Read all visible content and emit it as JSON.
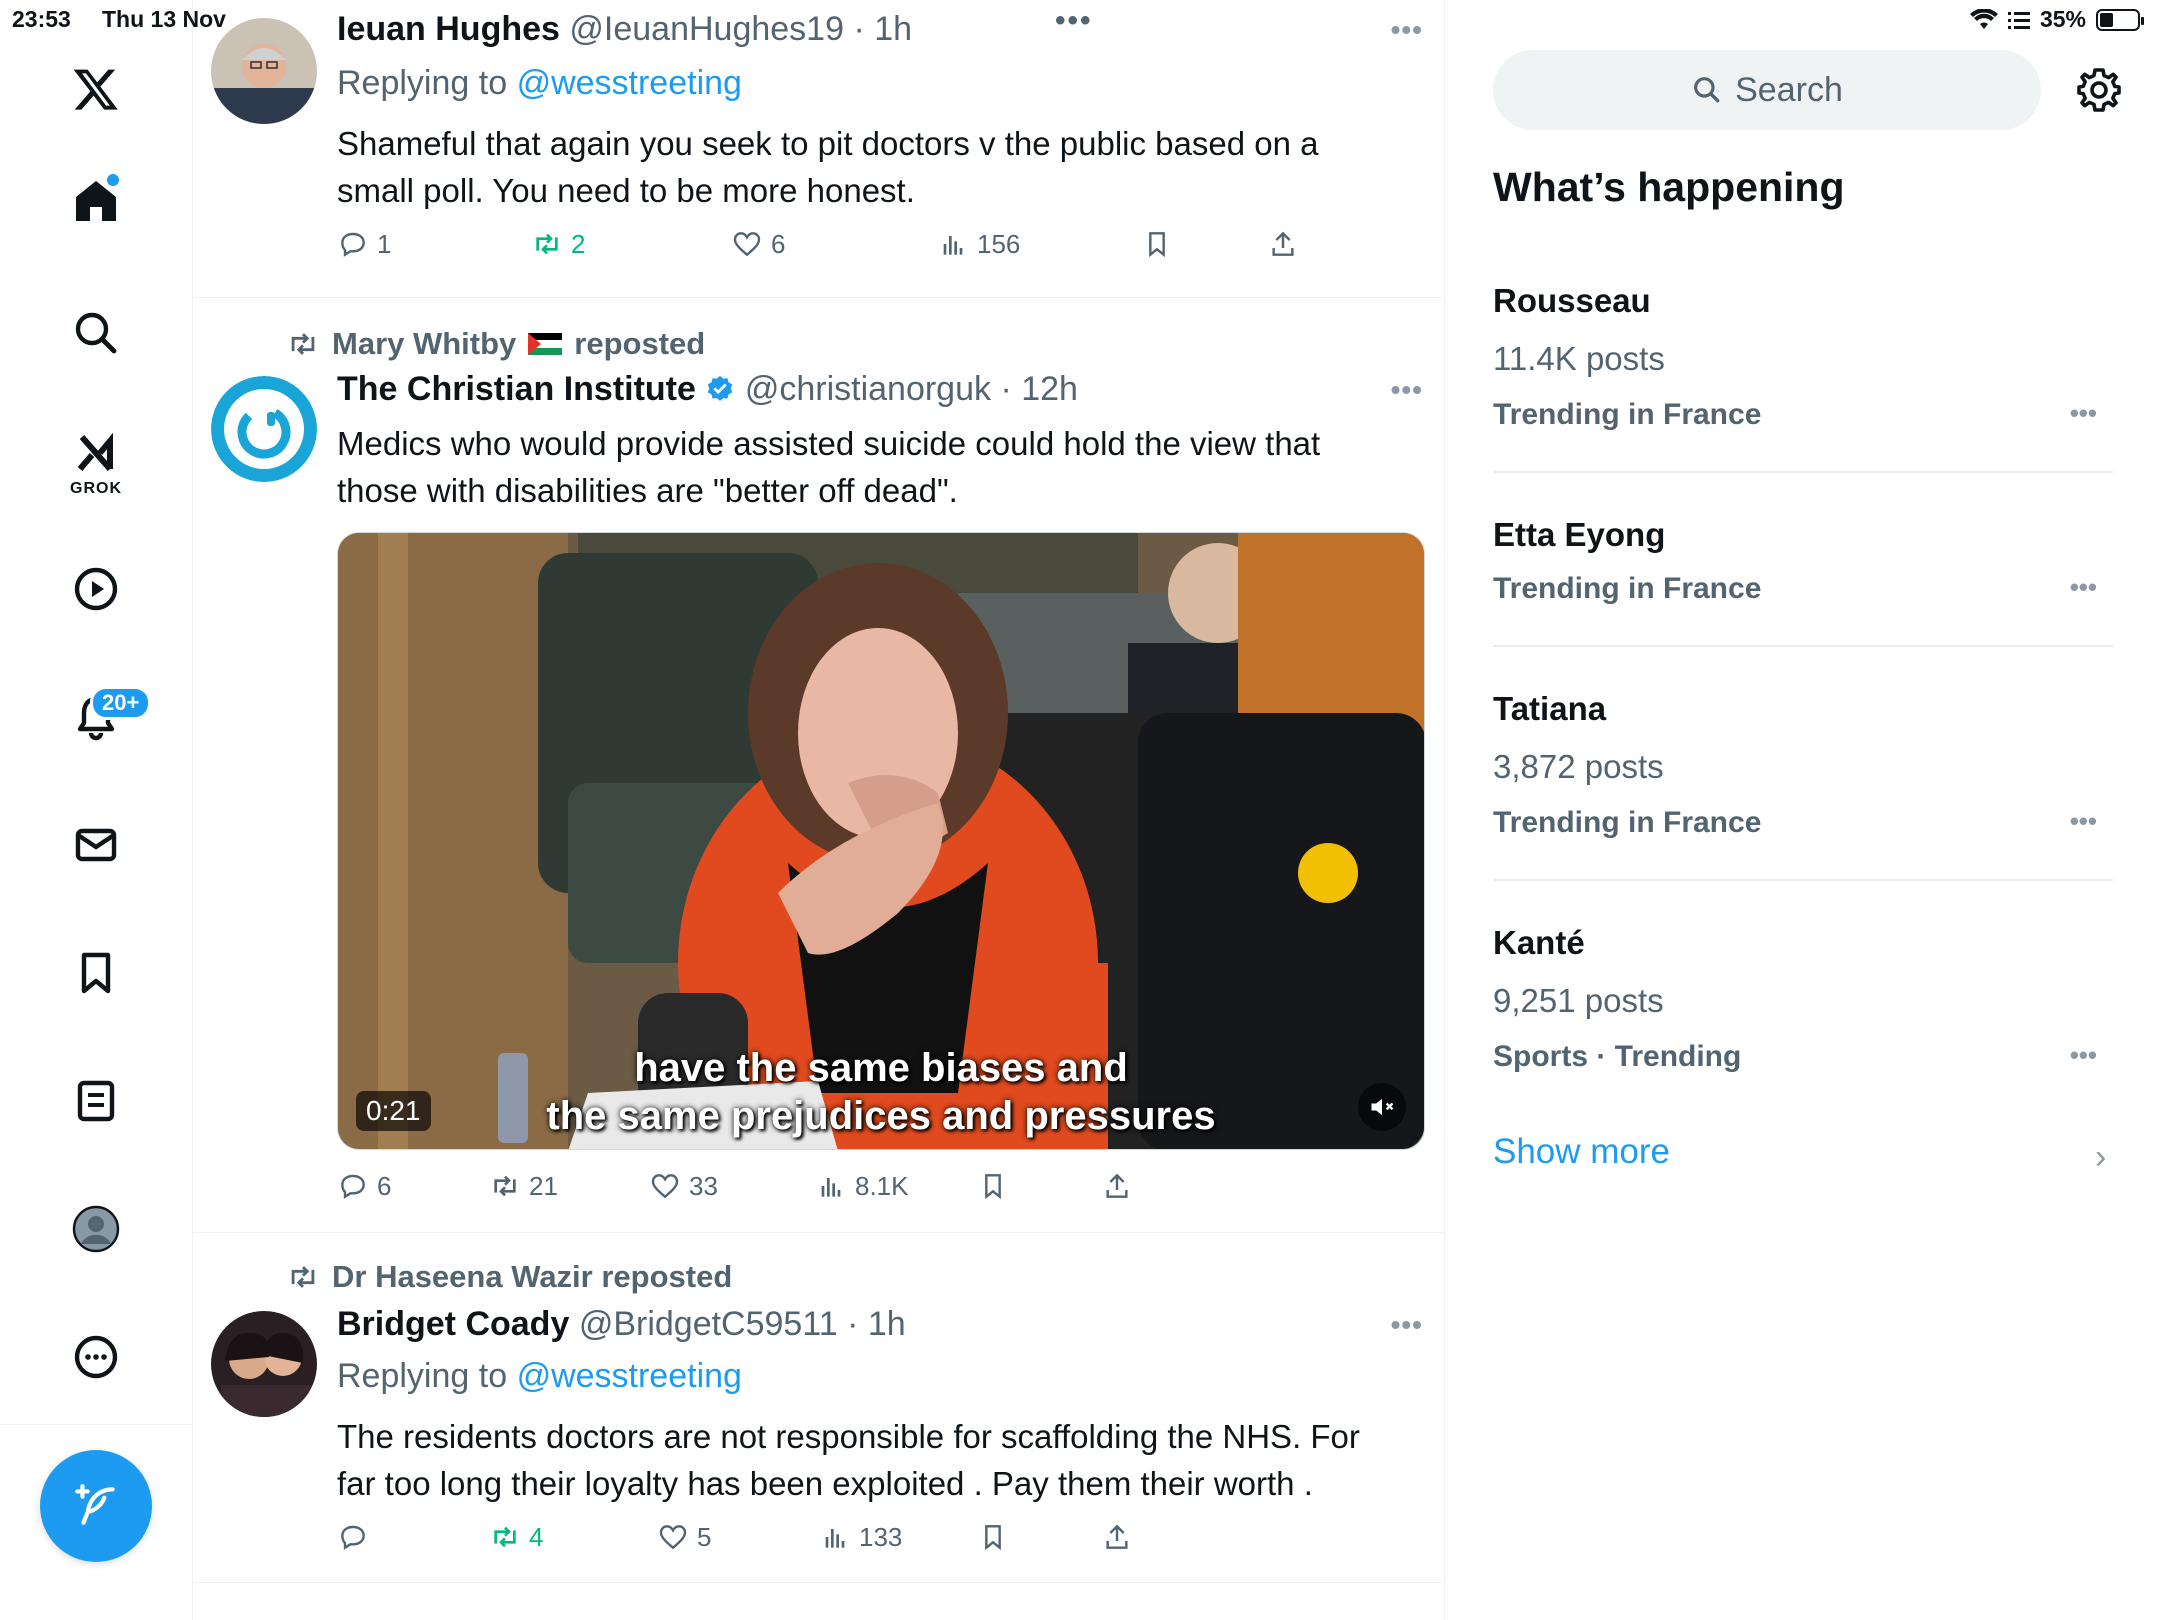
{
  "status_bar": {
    "time": "23:53",
    "date": "Thu 13 Nov",
    "battery_pct": "35%",
    "battery_level": 0.35
  },
  "nav": {
    "grok_label": "GROK",
    "notifications_badge": "20+"
  },
  "timeline": {
    "tweets": [
      {
        "name": "Ieuan Hughes",
        "handle": "@IeuanHughes19",
        "time": "1h",
        "replying_prefix": "Replying to",
        "replying_to": "@wesstreeting",
        "text": "Shameful that again you seek to pit doctors v the public based on a small poll. You need to be more honest.",
        "replies": "1",
        "reposts": "2",
        "likes": "6",
        "views": "156"
      },
      {
        "reposted_by": "Mary Whitby",
        "reposted_suffix": "reposted",
        "name": "The Christian Institute",
        "handle": "@christianorguk",
        "time": "12h",
        "text": "Medics who would provide assisted suicide could hold the view that those with disabilities are \"better off dead\".",
        "video_duration": "0:21",
        "caption_line1": "have the same biases and",
        "caption_line2": "the same prejudices and pressures",
        "replies": "6",
        "reposts": "21",
        "likes": "33",
        "views": "8.1K"
      },
      {
        "reposted_by": "Dr Haseena Wazir reposted",
        "name": "Bridget Coady",
        "handle": "@BridgetC59511",
        "time": "1h",
        "replying_prefix": "Replying to",
        "replying_to": "@wesstreeting",
        "text": "The residents doctors are not responsible for scaffolding the NHS. For far too long their loyalty has been exploited . Pay them their worth .",
        "replies": "",
        "reposts": "4",
        "likes": "5",
        "views": "133"
      }
    ]
  },
  "sidebar": {
    "search_placeholder": "Search",
    "title": "What’s happening",
    "trends": [
      {
        "name": "Rousseau",
        "posts": "11.4K posts",
        "context": "Trending in France"
      },
      {
        "name": "Etta Eyong",
        "posts": "",
        "context": "Trending in France"
      },
      {
        "name": "Tatiana",
        "posts": "3,872 posts",
        "context": "Trending in France"
      },
      {
        "name": "Kanté",
        "posts": "9,251 posts",
        "context": "Sports · Trending"
      }
    ],
    "show_more": "Show more"
  },
  "colors": {
    "accent": "#1d9bf0",
    "repost_green": "#00ba7c",
    "muted": "#536471"
  },
  "icons": [
    "x-logo-icon",
    "home-icon",
    "search-icon",
    "grok-icon",
    "video-icon",
    "bell-icon",
    "mail-icon",
    "bookmark-icon",
    "list-icon",
    "profile-icon",
    "more-icon",
    "compose-icon",
    "reply-icon",
    "repost-icon",
    "like-icon",
    "views-icon",
    "share-icon",
    "gear-icon",
    "verified-icon",
    "wifi-icon",
    "battery-icon",
    "mute-icon"
  ]
}
